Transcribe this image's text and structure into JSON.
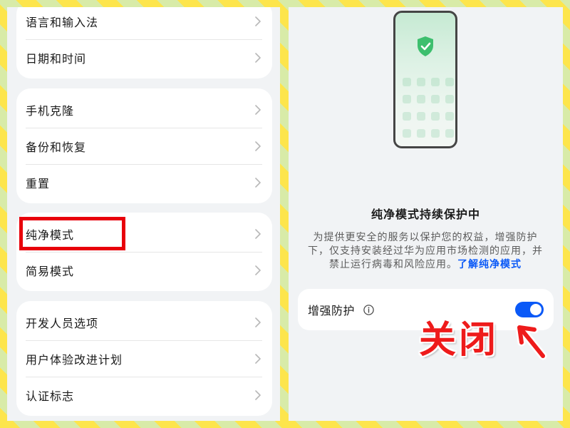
{
  "settings_list": {
    "groups": [
      {
        "items": [
          {
            "label": "语言和输入法"
          },
          {
            "label": "日期和时间"
          }
        ]
      },
      {
        "items": [
          {
            "label": "手机克隆"
          },
          {
            "label": "备份和恢复"
          },
          {
            "label": "重置"
          }
        ]
      },
      {
        "items": [
          {
            "label": "纯净模式",
            "highlighted": true
          },
          {
            "label": "简易模式"
          }
        ]
      },
      {
        "items": [
          {
            "label": "开发人员选项"
          },
          {
            "label": "用户体验改进计划"
          },
          {
            "label": "认证标志"
          }
        ]
      }
    ],
    "row_icon": "chevron-right-icon"
  },
  "pure_mode": {
    "illustration_icon": "phone-shield-check-icon",
    "title": "纯净模式持续保护中",
    "description": "为提供更安全的服务以保护您的权益，增强防护下，仅支持安装经过华为应用市场检测的应用，并禁止运行病毒和风险应用。",
    "learn_more_link": "了解纯净模式",
    "enhanced_protection": {
      "label": "增强防护",
      "info_icon": "info-icon",
      "toggle_on": true
    }
  },
  "annotation": {
    "text": "关闭",
    "arrow_icon": "arrow-up-left-icon"
  },
  "colors": {
    "accent": "#0a59f7",
    "annotation_red": "#ee1b1b",
    "highlight_red": "#e8000b",
    "shield_green": "#3dbf6e"
  }
}
